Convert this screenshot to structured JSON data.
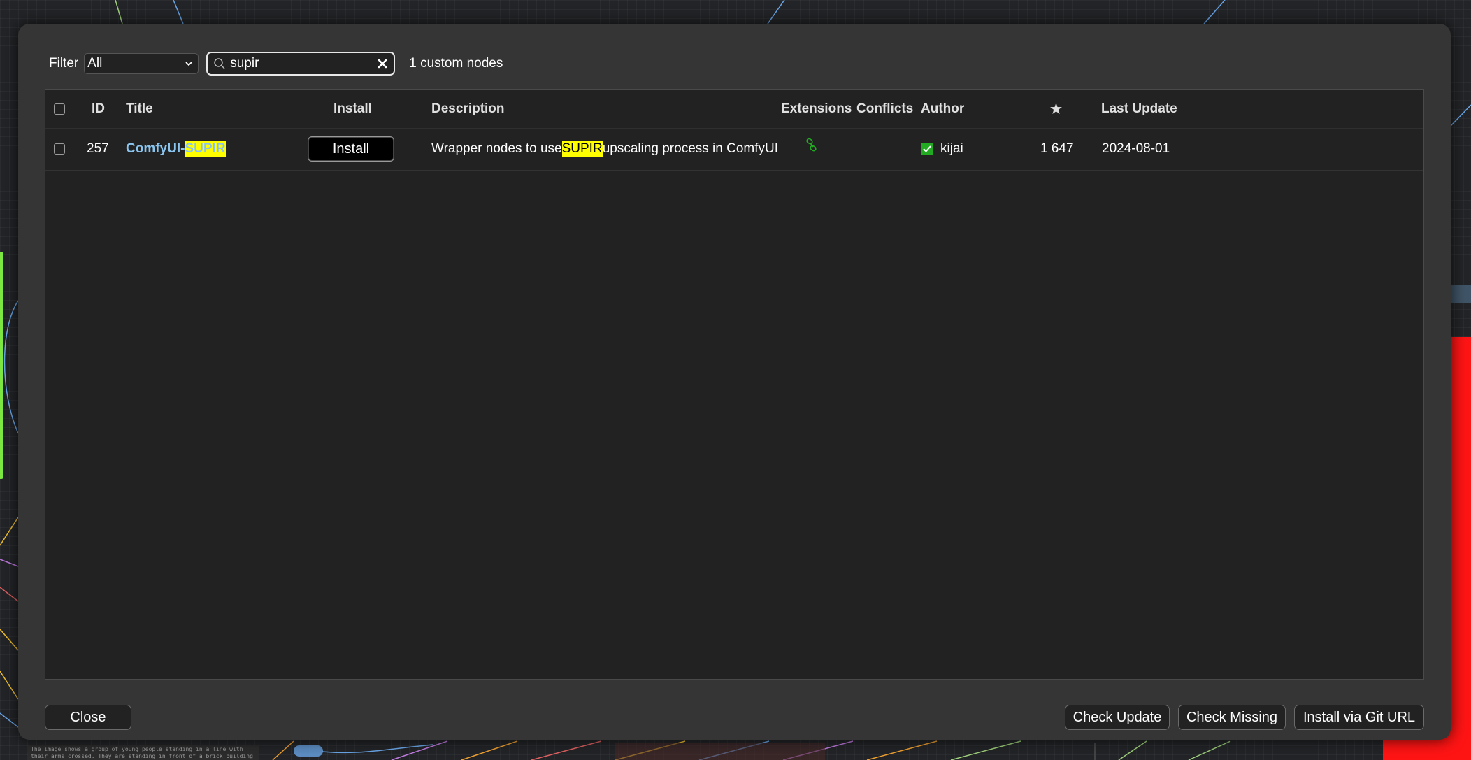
{
  "filter": {
    "label": "Filter",
    "selected": "All"
  },
  "search": {
    "value": "supir"
  },
  "result_count": "1 custom nodes",
  "table": {
    "columns": {
      "id": "ID",
      "title": "Title",
      "install": "Install",
      "description": "Description",
      "extensions": "Extensions",
      "conflicts": "Conflicts",
      "author": "Author",
      "stars": "★",
      "last_update": "Last Update"
    },
    "rows": [
      {
        "id": "257",
        "title_prefix": "ComfyUI-",
        "title_highlight": "SUPIR",
        "install_label": "Install",
        "description_before": "Wrapper nodes to use ",
        "description_highlight": "SUPIR",
        "description_after": " upscaling process in ComfyUI",
        "extensions_icon": "link-icon",
        "author_verified": true,
        "author": "kijai",
        "stars": "1 647",
        "last_update": "2024-08-01"
      }
    ]
  },
  "footer": {
    "close": "Close",
    "check_update": "Check Update",
    "check_missing": "Check Missing",
    "install_git": "Install via Git URL"
  },
  "background": {
    "node_text": "The image shows a group of young people standing in a line with their arms crossed. They are standing in front of a brick building with a"
  },
  "colors": {
    "accent_link": "#8ac4ee",
    "highlight": "#ffff00",
    "verified": "#22aa22"
  }
}
